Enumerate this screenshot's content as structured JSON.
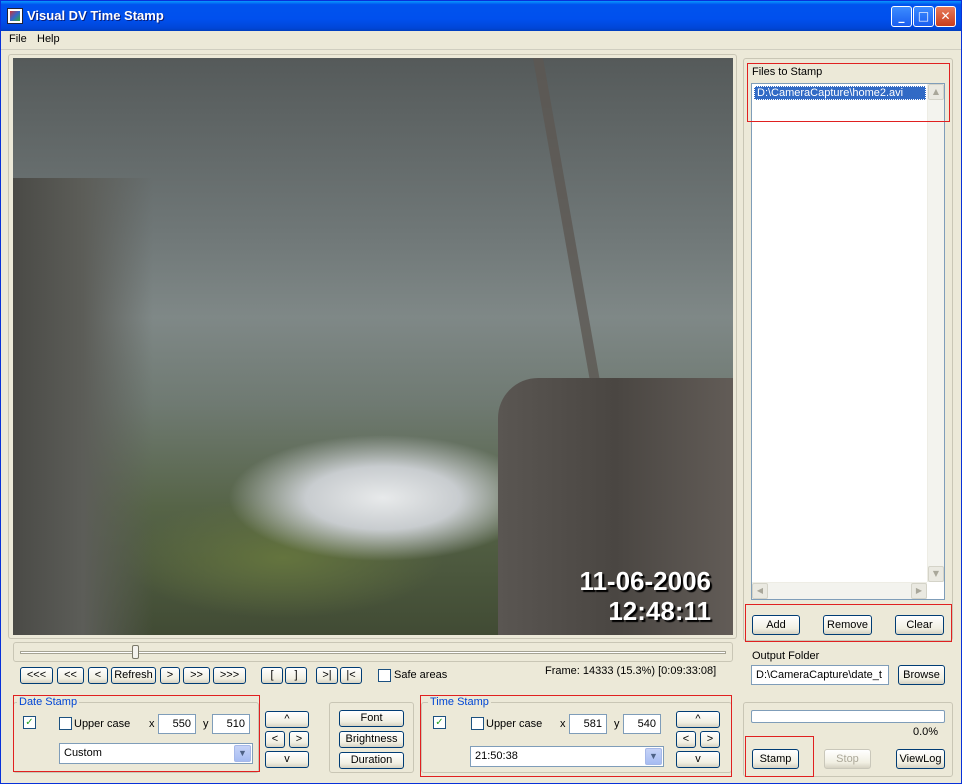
{
  "window": {
    "title": "Visual DV Time Stamp"
  },
  "menu": {
    "file": "File",
    "help": "Help"
  },
  "video": {
    "date_overlay": "11-06-2006",
    "time_overlay": "12:48:11"
  },
  "slider": {
    "position_fraction": 0.16
  },
  "nav": {
    "first": "<<<",
    "prev_big": "<<",
    "prev": "<",
    "refresh": "Refresh",
    "next": ">",
    "next_big": ">>",
    "last": ">>>",
    "mark_in": "[",
    "mark_out": "]",
    "goto_end": ">|",
    "goto_start": "|<",
    "safe_areas": "Safe areas",
    "frame_info": "Frame: 14333 (15.3%) [0:09:33:08]"
  },
  "date_stamp": {
    "title": "Date Stamp",
    "enabled": "✓",
    "upper_case": "Upper case",
    "x_label": "x",
    "x": "550",
    "y_label": "y",
    "y": "510",
    "format": "Custom",
    "up": "^",
    "left": "<",
    "right": ">",
    "down": "v"
  },
  "style_buttons": {
    "font": "Font",
    "brightness": "Brightness",
    "duration": "Duration"
  },
  "time_stamp": {
    "title": "Time Stamp",
    "enabled": "✓",
    "upper_case": "Upper case",
    "x_label": "x",
    "x": "581",
    "y_label": "y",
    "y": "540",
    "format": "21:50:38",
    "up": "^",
    "left": "<",
    "right": ">",
    "down": "v"
  },
  "files": {
    "title": "Files to Stamp",
    "items": [
      "D:\\CameraCapture\\home2.avi"
    ]
  },
  "file_buttons": {
    "add": "Add",
    "remove": "Remove",
    "clear": "Clear"
  },
  "output": {
    "title": "Output Folder",
    "path": "D:\\CameraCapture\\date_t",
    "browse": "Browse"
  },
  "progress": {
    "value_fraction": 0.0,
    "percent_text": "0.0%"
  },
  "actions": {
    "stamp": "Stamp",
    "stop": "Stop",
    "viewlog": "ViewLog"
  },
  "colors": {
    "title_bar": "#0054e3",
    "highlight_box": "#e02020",
    "selection": "#316ac5",
    "group_title": "#0046d5"
  }
}
